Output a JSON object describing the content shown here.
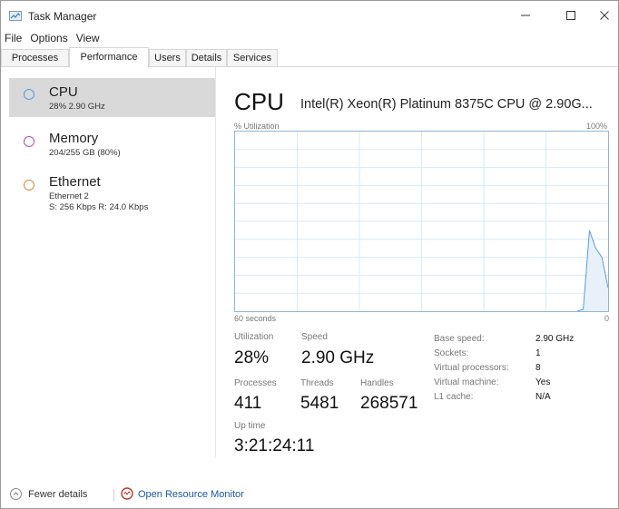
{
  "window": {
    "title": "Task Manager"
  },
  "menu": [
    "File",
    "Options",
    "View"
  ],
  "tabs": [
    "Processes",
    "Performance",
    "Users",
    "Details",
    "Services"
  ],
  "active_tab": "Performance",
  "resources": [
    {
      "name": "CPU",
      "sub": "28%  2.90 GHz",
      "color": "#5a9be0"
    },
    {
      "name": "Memory",
      "sub": "204/255 GB (80%)",
      "color": "#b34db3"
    },
    {
      "name": "Ethernet",
      "sub": "Ethernet 2",
      "sub2": "S: 256 Kbps  R: 24.0 Kbps",
      "color": "#d18a3c"
    }
  ],
  "detail": {
    "title": "CPU",
    "model": "Intel(R) Xeon(R) Platinum 8375C CPU @ 2.90G...",
    "util_label": "% Utilization",
    "max_label": "100%",
    "time_label": "60 seconds",
    "zero_label": "0",
    "stats": {
      "utilization_label": "Utilization",
      "utilization": "28%",
      "speed_label": "Speed",
      "speed": "2.90 GHz",
      "processes_label": "Processes",
      "processes": "411",
      "threads_label": "Threads",
      "threads": "5481",
      "handles_label": "Handles",
      "handles": "268571",
      "uptime_label": "Up time",
      "uptime": "3:21:24:11"
    },
    "specs": [
      {
        "k": "Base speed:",
        "v": "2.90 GHz"
      },
      {
        "k": "Sockets:",
        "v": "1"
      },
      {
        "k": "Virtual processors:",
        "v": "8"
      },
      {
        "k": "Virtual machine:",
        "v": "Yes"
      },
      {
        "k": "L1 cache:",
        "v": "N/A"
      }
    ],
    "graph_series_percent": [
      0,
      0,
      0,
      0,
      0,
      0,
      0,
      0,
      0,
      0,
      0,
      0,
      0,
      0,
      0,
      0,
      0,
      0,
      0,
      0,
      0,
      0,
      0,
      0,
      0,
      0,
      0,
      0,
      0,
      0,
      0,
      0,
      0,
      0,
      0,
      0,
      0,
      0,
      0,
      0,
      0,
      0,
      0,
      0,
      0,
      0,
      0,
      0,
      0,
      0,
      0,
      0,
      0,
      0,
      0,
      0,
      1,
      45,
      35,
      30,
      13
    ]
  },
  "footer": {
    "fewer": "Fewer details",
    "open_monitor": "Open Resource Monitor"
  },
  "colors": {
    "graph_border": "#8db6d9",
    "graph_grid": "#d9e8f5",
    "graph_line": "#5a9be0",
    "graph_fill": "#e8f1fa"
  }
}
